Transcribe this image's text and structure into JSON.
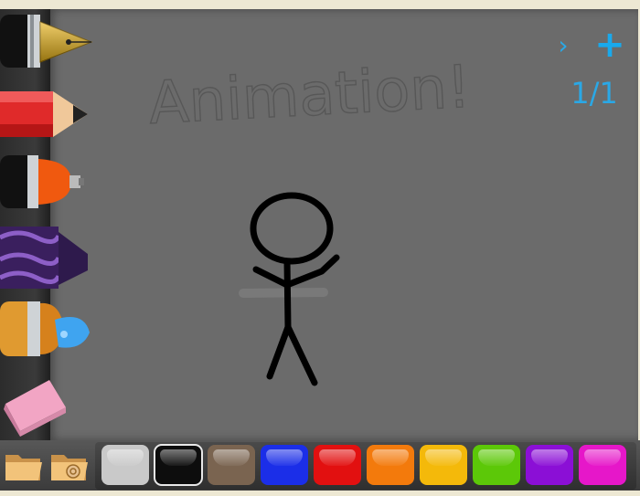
{
  "tools": [
    {
      "name": "fountain-pen",
      "label": "Pen"
    },
    {
      "name": "pencil",
      "label": "Pencil"
    },
    {
      "name": "spray-can",
      "label": "Spray"
    },
    {
      "name": "crayon",
      "label": "Crayon"
    },
    {
      "name": "paint-brush",
      "label": "Brush"
    },
    {
      "name": "eraser",
      "label": "Eraser"
    }
  ],
  "canvas": {
    "handwritten_text": "Animation!"
  },
  "frame_nav": {
    "next_symbol": "›",
    "add_symbol": "+",
    "counter": "1/1"
  },
  "colors": {
    "canvas_bg": "#6b6b6b",
    "accent": "#2aa8e6"
  },
  "palette": [
    {
      "name": "light-gray",
      "hex": "#c9c9c9"
    },
    {
      "name": "black",
      "hex": "#0d0d0d",
      "selected": true
    },
    {
      "name": "brown",
      "hex": "#7a6450"
    },
    {
      "name": "blue",
      "hex": "#1b2ee8"
    },
    {
      "name": "red",
      "hex": "#e21010"
    },
    {
      "name": "orange",
      "hex": "#f37a0c"
    },
    {
      "name": "yellow",
      "hex": "#f4b90a"
    },
    {
      "name": "green",
      "hex": "#5cc808"
    },
    {
      "name": "purple",
      "hex": "#8b0fd6"
    },
    {
      "name": "magenta",
      "hex": "#e617c9"
    }
  ],
  "bottom_icons": [
    {
      "name": "open-folder-icon"
    },
    {
      "name": "save-scroll-icon"
    }
  ]
}
